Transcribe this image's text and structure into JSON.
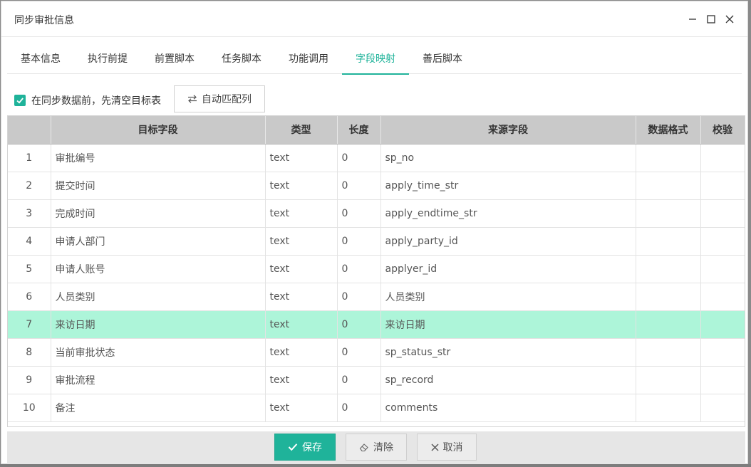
{
  "dialog": {
    "title": "同步审批信息"
  },
  "tabs": [
    {
      "label": "基本信息",
      "active": false
    },
    {
      "label": "执行前提",
      "active": false
    },
    {
      "label": "前置脚本",
      "active": false
    },
    {
      "label": "任务脚本",
      "active": false
    },
    {
      "label": "功能调用",
      "active": false
    },
    {
      "label": "字段映射",
      "active": true
    },
    {
      "label": "善后脚本",
      "active": false
    }
  ],
  "toolbar": {
    "clear_before_sync_label": "在同步数据前，先清空目标表",
    "clear_before_sync_checked": true,
    "auto_match_label": "自动匹配列"
  },
  "table": {
    "columns": [
      "",
      "目标字段",
      "类型",
      "长度",
      "来源字段",
      "数据格式",
      "校验"
    ],
    "rows": [
      {
        "no": "1",
        "target": "审批编号",
        "type": "text",
        "length": "0",
        "source": "sp_no",
        "format": "",
        "check": ""
      },
      {
        "no": "2",
        "target": "提交时间",
        "type": "text",
        "length": "0",
        "source": "apply_time_str",
        "format": "",
        "check": ""
      },
      {
        "no": "3",
        "target": "完成时间",
        "type": "text",
        "length": "0",
        "source": "apply_endtime_str",
        "format": "",
        "check": ""
      },
      {
        "no": "4",
        "target": "申请人部门",
        "type": "text",
        "length": "0",
        "source": "apply_party_id",
        "format": "",
        "check": ""
      },
      {
        "no": "5",
        "target": "申请人账号",
        "type": "text",
        "length": "0",
        "source": "applyer_id",
        "format": "",
        "check": ""
      },
      {
        "no": "6",
        "target": "人员类别",
        "type": "text",
        "length": "0",
        "source": "人员类别",
        "format": "",
        "check": ""
      },
      {
        "no": "7",
        "target": "来访日期",
        "type": "text",
        "length": "0",
        "source": "来访日期",
        "format": "",
        "check": ""
      },
      {
        "no": "8",
        "target": "当前审批状态",
        "type": "text",
        "length": "0",
        "source": "sp_status_str",
        "format": "",
        "check": ""
      },
      {
        "no": "9",
        "target": "审批流程",
        "type": "text",
        "length": "0",
        "source": "sp_record",
        "format": "",
        "check": ""
      },
      {
        "no": "10",
        "target": "备注",
        "type": "text",
        "length": "0",
        "source": "comments",
        "format": "",
        "check": ""
      }
    ],
    "selected_row": 6
  },
  "footer": {
    "save_label": "保存",
    "clear_label": "清除",
    "cancel_label": "取消"
  },
  "colors": {
    "accent": "#1fb39a",
    "selected_row": "#adf5d9",
    "header_bg": "#c9c9c9"
  },
  "icons": {
    "minimize": "minimize-icon",
    "maximize": "maximize-icon",
    "close": "close-icon",
    "check": "checkmark-icon",
    "swap": "swap-arrows-icon",
    "eraser": "eraser-icon",
    "cancel": "x-icon"
  }
}
